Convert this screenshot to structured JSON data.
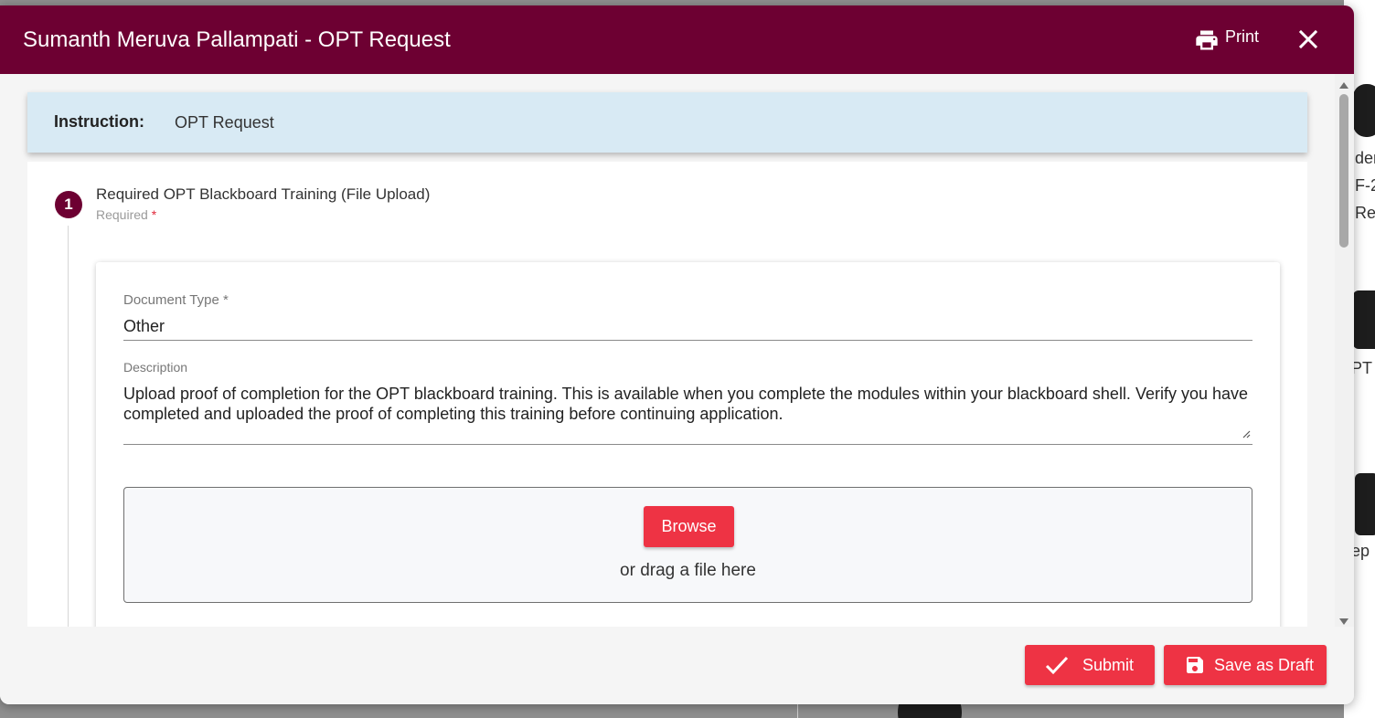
{
  "modal": {
    "title": "Sumanth Meruva Pallampati - OPT Request",
    "print_label": "Print"
  },
  "instruction": {
    "label": "Instruction:",
    "value": "OPT Request"
  },
  "step": {
    "number": "1",
    "title": "Required OPT Blackboard Training (File Upload)",
    "required_text": "Required",
    "required_marker": "*"
  },
  "document": {
    "type_label": "Document Type *",
    "type_value": "Other",
    "description_label": "Description",
    "description_value": "Upload proof of completion for the OPT blackboard training.  This is available when you complete the modules within your blackboard shell.  Verify you have completed and uploaded the proof of completing this training before continuing application."
  },
  "upload": {
    "browse_label": "Browse",
    "drag_text": "or drag a file here"
  },
  "footer": {
    "submit_label": "Submit",
    "draft_label": "Save as Draft"
  },
  "background": {
    "fragments": [
      "den",
      "F-2",
      "Re",
      "PT",
      "ep"
    ]
  },
  "colors": {
    "header": "#6d0032",
    "accent_button": "#ee3344",
    "instruction_bg": "#d8eaf4"
  }
}
